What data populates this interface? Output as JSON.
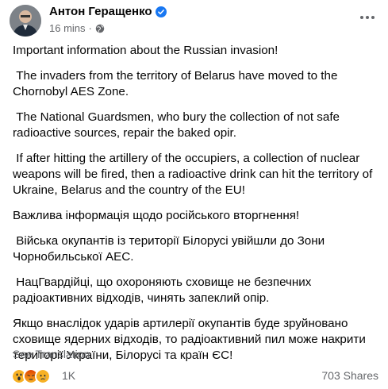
{
  "header": {
    "author": "Антон Геращенко",
    "timestamp": "16 mins",
    "meta_separator": "·",
    "verified_icon": "verified-badge-icon",
    "audience_icon": "globe-icon",
    "more_icon": "more-options-icon"
  },
  "post": {
    "paragraphs": [
      "Important information about the Russian invasion!",
      " The invaders from the territory of Belarus have moved to the Chornobyl AES Zone.",
      " The National Guardsmen, who bury the collection of not safe radioactive sources, repair the baked opir.",
      " If after hitting the artillery of the occupiers, a collection of nuclear weapons will be fired, then a radioactive drink can hit the territory of Ukraine, Belarus and the country of the EU!",
      "Важлива інформація щодо російського вторгнення!",
      " Війська окупантів із території Білорусі увійшли до Зони Чорнобильської АЕС.",
      " НацГвардійці, що охороняють сховище не безпечних радіоактивних відходів, чинять запеклий опір.",
      "Якщо внаслідок ударів артилерії окупантів буде зруйновано сховище ядерних відходів, то радіоактивний пил може накрити території України, Білорусі та країн ЄС!"
    ],
    "see_translation": "See Translation"
  },
  "footer": {
    "reaction_count": "1K",
    "shares": "703 Shares",
    "reactions": [
      "wow-reaction-icon",
      "angry-reaction-icon",
      "sad-reaction-icon"
    ]
  },
  "colors": {
    "text": "#050505",
    "secondary_text": "#65676b",
    "verified": "#1877f2",
    "angry": "#e9710f",
    "wow_sad": "#f7b125"
  }
}
